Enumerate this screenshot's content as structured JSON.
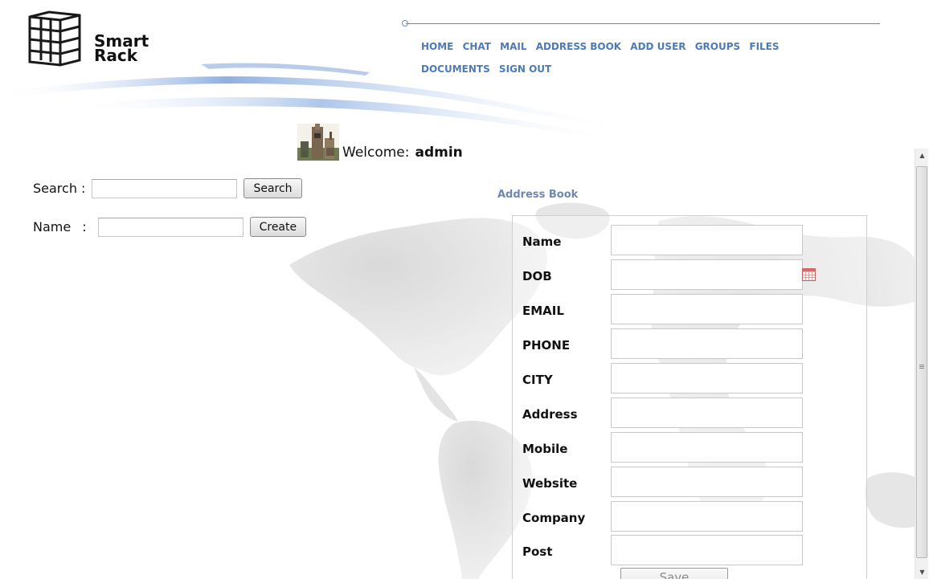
{
  "brand": {
    "line1": "Smart",
    "line2": "Rack"
  },
  "nav": {
    "items": [
      {
        "label": "HOME"
      },
      {
        "label": "CHAT"
      },
      {
        "label": "MAIL"
      },
      {
        "label": "ADDRESS BOOK"
      },
      {
        "label": "ADD USER"
      },
      {
        "label": "GROUPS"
      },
      {
        "label": "FILES"
      },
      {
        "label": "DOCUMENTS"
      },
      {
        "label": "SIGN OUT"
      }
    ]
  },
  "welcome": {
    "label": "Welcome:",
    "user": "admin"
  },
  "search": {
    "label": "Search :",
    "value": "",
    "button": "Search"
  },
  "create": {
    "label": "Name",
    "colon": ":",
    "value": "",
    "button": "Create"
  },
  "address_book": {
    "title": "Address Book",
    "fields": [
      {
        "label": "Name",
        "value": ""
      },
      {
        "label": "DOB",
        "value": ""
      },
      {
        "label": "EMAIL",
        "value": ""
      },
      {
        "label": "PHONE",
        "value": ""
      },
      {
        "label": "CITY",
        "value": ""
      },
      {
        "label": "Address",
        "value": ""
      },
      {
        "label": "Mobile",
        "value": ""
      },
      {
        "label": "Website",
        "value": ""
      },
      {
        "label": "Company",
        "value": ""
      },
      {
        "label": "Post",
        "value": ""
      }
    ],
    "save_button": "Save"
  },
  "colors": {
    "nav_link": "#4d7bb8",
    "section_title": "#6f88b2"
  },
  "icons": {
    "calendar": "calendar-icon",
    "logo": "rack-logo-icon",
    "avatar": "admin-avatar"
  }
}
